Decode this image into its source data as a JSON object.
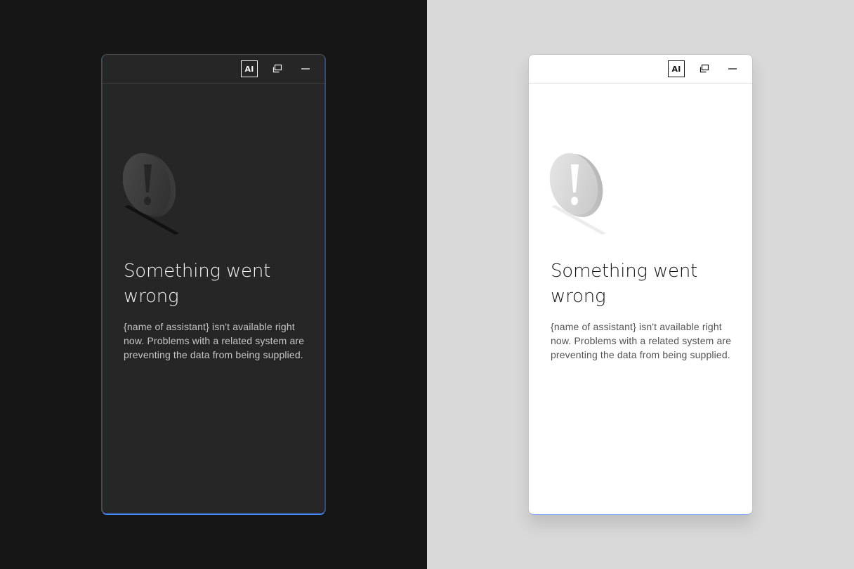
{
  "theme_dark": {
    "header": {
      "ai_label": "AI",
      "expand_icon": "popout-icon",
      "minimize_icon": "minimize-icon"
    },
    "illustration": "warning-exclamation-illustration",
    "error": {
      "title": "Something went wrong",
      "message": "{name of assistant} isn't available right now. Problems with a related system are preventing the data from being supplied."
    }
  },
  "theme_light": {
    "header": {
      "ai_label": "AI",
      "expand_icon": "popout-icon",
      "minimize_icon": "minimize-icon"
    },
    "illustration": "warning-exclamation-illustration",
    "error": {
      "title": "Something went wrong",
      "message": "{name of assistant} isn't available right now. Problems with a related system are preventing the data from being supplied."
    }
  },
  "colors": {
    "dark_background": "#161616",
    "dark_panel": "#262626",
    "light_background": "#d9d9d9",
    "light_panel": "#ffffff",
    "focus_accent": "#4589ff"
  }
}
